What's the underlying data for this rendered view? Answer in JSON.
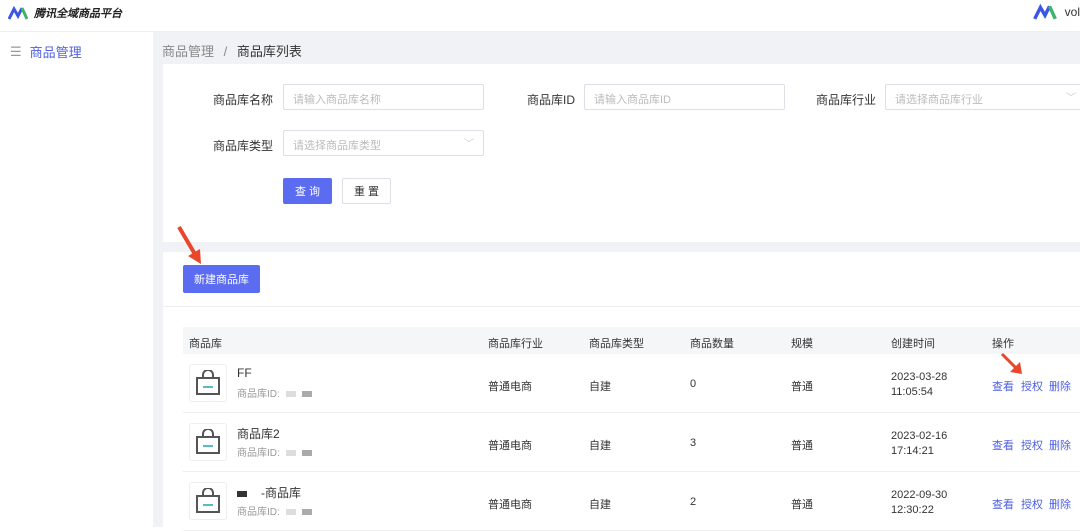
{
  "header": {
    "title": "腾讯全域商品平台",
    "user": "vol"
  },
  "sidebar": {
    "items": [
      {
        "label": "商品管理"
      }
    ]
  },
  "breadcrumb": {
    "parent": "商品管理",
    "sep": "/",
    "current": "商品库列表"
  },
  "filters": {
    "name": {
      "label": "商品库名称",
      "placeholder": "请输入商品库名称"
    },
    "id": {
      "label": "商品库ID",
      "placeholder": "请输入商品库ID"
    },
    "industry": {
      "label": "商品库行业",
      "placeholder": "请选择商品库行业"
    },
    "type": {
      "label": "商品库类型",
      "placeholder": "请选择商品库类型"
    },
    "search": "查 询",
    "reset": "重 置"
  },
  "create_button": "新建商品库",
  "table": {
    "columns": [
      "商品库",
      "商品库行业",
      "商品库类型",
      "商品数量",
      "规模",
      "创建时间",
      "操作"
    ],
    "rows": [
      {
        "name": "FF",
        "id_label": "商品库ID:",
        "industry": "普通电商",
        "type": "自建",
        "count": "0",
        "scale": "普通",
        "date": "2023-03-28",
        "time": "11:05:54"
      },
      {
        "name": "商品库2",
        "id_label": "商品库ID:",
        "industry": "普通电商",
        "type": "自建",
        "count": "3",
        "scale": "普通",
        "date": "2023-02-16",
        "time": "17:14:21"
      },
      {
        "name": "-商品库",
        "id_label": "商品库ID:",
        "industry": "普通电商",
        "type": "自建",
        "count": "2",
        "scale": "普通",
        "date": "2022-09-30",
        "time": "12:30:22"
      }
    ],
    "actions": {
      "view": "查看",
      "auth": "授权",
      "delete": "删除"
    }
  },
  "colors": {
    "accent": "#5b6cf0",
    "link": "#4d5fe0",
    "arrow": "#e8472b"
  }
}
